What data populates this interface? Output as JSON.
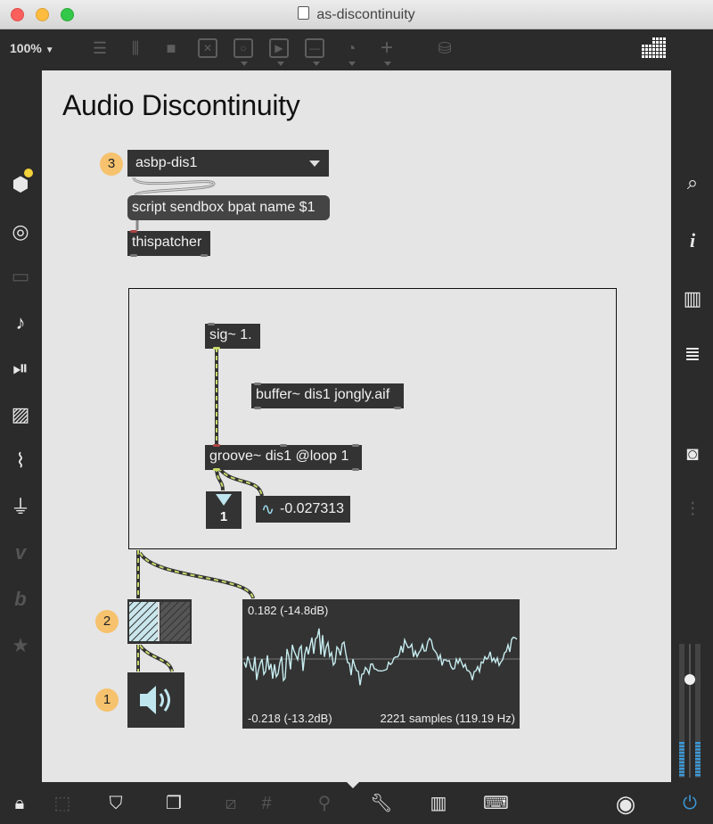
{
  "window": {
    "title": "as-discontinuity"
  },
  "toolbar": {
    "zoom": "100%",
    "zoom_caret": "▼"
  },
  "patch": {
    "title": "Audio Discontinuity",
    "umenu": {
      "value": "asbp-dis1"
    },
    "badges": {
      "b3": "3",
      "b2": "2",
      "b1": "1"
    },
    "objects": {
      "script_msg": "script sendbox bpat name $1",
      "thispatcher": "thispatcher",
      "sig": "sig~ 1.",
      "buffer": "buffer~ dis1 jongly.aif",
      "groove": "groove~ dis1 @loop 1",
      "number": "1",
      "number_tilde": "-0.027313"
    },
    "scope": {
      "max_label": "0.182 (-14.8dB)",
      "min_label": "-0.218 (-13.2dB)",
      "samples_label": "2221 samples (119.19 Hz)"
    }
  },
  "colors": {
    "accent": "#f6c26d",
    "signal_wire": "#c9d96a",
    "meter": "#3a9ad9"
  }
}
